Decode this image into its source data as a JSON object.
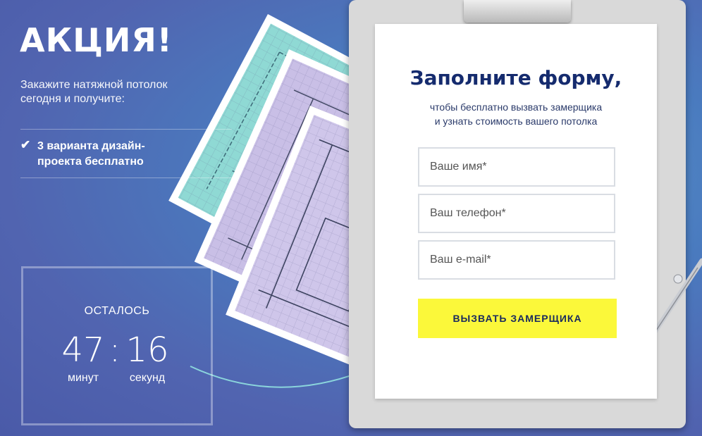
{
  "promo": {
    "title": "АКЦИЯ!",
    "subtitle": "Закажите натяжной потолок сегодня и получите:",
    "benefit": "3 варианта дизайн-проекта бесплатно",
    "check_icon": "checkmark-icon"
  },
  "timer": {
    "label": "ОСТАЛОСЬ",
    "minutes": "47",
    "separator": ":",
    "seconds": "16",
    "minutes_label": "минут",
    "seconds_label": "секунд"
  },
  "form": {
    "title": "Заполните форму,",
    "description_line1": "чтобы бесплатно вызвать замерщика",
    "description_line2": "и узнать стоимость вашего потолка",
    "name_placeholder": "Ваше имя*",
    "phone_placeholder": "Ваш телефон*",
    "email_placeholder": "Ваш e-mail*",
    "submit_label": "ВЫЗВАТЬ ЗАМЕРЩИКА"
  },
  "colors": {
    "accent": "#fbf83a",
    "title": "#152b6e",
    "background": "#4a7bbf"
  }
}
